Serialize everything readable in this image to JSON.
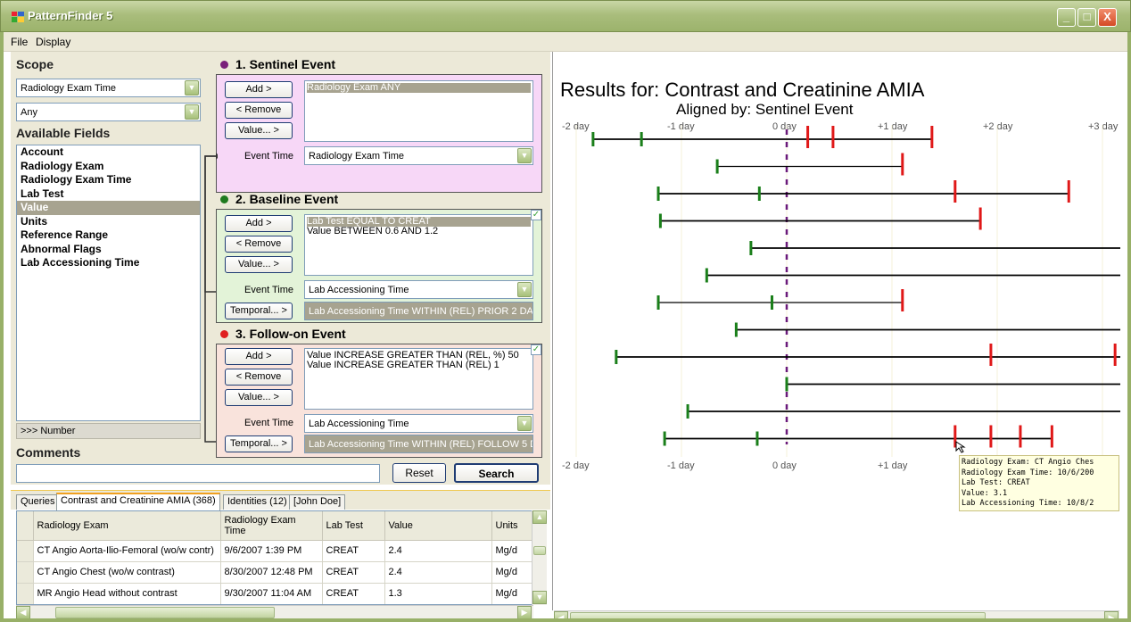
{
  "window": {
    "title": "PatternFinder 5",
    "minimize": "_",
    "maximize": "□",
    "close": "X"
  },
  "menu": [
    "File",
    "Display"
  ],
  "scope": {
    "label": "Scope",
    "field": "Radiology Exam Time",
    "qualifier": "Any"
  },
  "available_fields": {
    "label": "Available Fields",
    "items": [
      "Account",
      "Radiology Exam",
      "Radiology Exam Time",
      "Lab Test",
      "Value",
      "Units",
      "Reference Range",
      "Abnormal Flags",
      "Lab Accessioning Time"
    ],
    "selected": "Value",
    "number_button": ">>> Number"
  },
  "buttons": {
    "add": "Add >",
    "remove": "< Remove",
    "value": "Value... >",
    "temporal": "Temporal... >"
  },
  "events": [
    {
      "title": "1. Sentinel Event",
      "dot_color": "#7a1f7a",
      "bg": "#f7d7f7",
      "conditions": [
        "Radiology Exam ANY"
      ],
      "highlight_first": true,
      "time_label": "Event Time",
      "time_value": "Radiology Exam Time"
    },
    {
      "title": "2. Baseline Event",
      "dot_color": "#1f7a1f",
      "bg": "#e3f3d8",
      "conditions": [
        "Lab Test EQUAL TO CREAT",
        "Value BETWEEN 0.6 AND 1.2"
      ],
      "highlight_first": true,
      "time_label": "Event Time",
      "time_value": "Lab Accessioning Time",
      "temporal": "Lab Accessioning Time WITHIN (REL) PRIOR 2 DA"
    },
    {
      "title": "3.  Follow-on Event",
      "dot_color": "#e02020",
      "bg": "#f9e3dc",
      "conditions": [
        "Value INCREASE GREATER THAN (REL, %) 50",
        "Value INCREASE GREATER THAN (REL) 1"
      ],
      "highlight_first": false,
      "time_label": "Event Time",
      "time_value": "Lab Accessioning Time",
      "temporal": "Lab Accessioning Time WITHIN (REL) FOLLOW 5 D"
    }
  ],
  "comments": {
    "label": "Comments",
    "value": ""
  },
  "actions": {
    "reset": "Reset",
    "search": "Search"
  },
  "tabs": [
    "Queries",
    "Contrast and Creatinine AMIA  (368)",
    "Identities (12)",
    "[John Doe]"
  ],
  "active_tab": 1,
  "grid": {
    "columns": [
      "Radiology Exam",
      "Radiology Exam Time",
      "Lab Test",
      "Value",
      "Units"
    ],
    "rows": [
      [
        "CT Angio Aorta-Ilio-Femoral (wo/w contr)",
        "9/6/2007 1:39 PM",
        "CREAT",
        "2.4",
        "Mg/d"
      ],
      [
        "CT Angio Chest (wo/w contrast)",
        "8/30/2007 12:48 PM",
        "CREAT",
        "2.4",
        "Mg/d"
      ],
      [
        "MR Angio Head without contrast",
        "9/30/2007 11:04 AM",
        "CREAT",
        "1.3",
        "Mg/d"
      ]
    ]
  },
  "results": {
    "title": "Results for: Contrast and Creatinine AMIA",
    "aligned_by": "Aligned by: Sentinel Event",
    "top_ticks": [
      "-2 day",
      "-1 day",
      "0 day",
      "+1 day",
      "+2 day",
      "+3 day"
    ],
    "bottom_ticks": [
      "-2 day",
      "-1 day",
      "0 day",
      "+1 day"
    ],
    "colors": {
      "baseline": "#1a7f1a",
      "followon": "#e01818",
      "sentinel": "#6a1a7a",
      "grid": "#f4f0d8"
    },
    "timelines": [
      {
        "start": -1.84,
        "end": 1.38,
        "baseline": [
          -1.84,
          -1.38
        ],
        "followon": [
          0.2,
          0.44,
          1.38
        ]
      },
      {
        "start": -0.66,
        "end": 1.1,
        "baseline": [
          -0.66
        ],
        "followon": [
          1.1
        ]
      },
      {
        "start": -1.22,
        "end": 2.68,
        "baseline": [
          -1.22,
          -0.26
        ],
        "followon": [
          1.6,
          2.68
        ]
      },
      {
        "start": -1.2,
        "end": 1.84,
        "baseline": [
          -1.2
        ],
        "followon": [
          1.84
        ]
      },
      {
        "start": -0.34,
        "end": 3.2,
        "baseline": [
          -0.34
        ],
        "followon": []
      },
      {
        "start": -0.76,
        "end": 3.2,
        "baseline": [
          -0.76
        ],
        "followon": []
      },
      {
        "start": -1.22,
        "end": 1.1,
        "baseline": [
          -1.22,
          -0.14
        ],
        "followon": [
          1.1
        ]
      },
      {
        "start": -0.48,
        "end": 3.2,
        "baseline": [
          -0.48
        ],
        "followon": []
      },
      {
        "start": -1.62,
        "end": 3.2,
        "baseline": [
          -1.62
        ],
        "followon": [
          1.94,
          3.12
        ]
      },
      {
        "start": 0.0,
        "end": 3.2,
        "baseline": [
          0.0
        ],
        "followon": []
      },
      {
        "start": -0.94,
        "end": 3.2,
        "baseline": [
          -0.94
        ],
        "followon": []
      },
      {
        "start": -1.16,
        "end": 2.52,
        "baseline": [
          -1.16,
          -0.28
        ],
        "followon": [
          1.6,
          1.94,
          2.22,
          2.52
        ]
      }
    ],
    "tooltip": [
      "Radiology Exam: CT Angio Ches",
      "Radiology Exam Time: 10/6/200",
      "Lab Test: CREAT",
      "Value: 3.1",
      "Lab Accessioning Time: 10/8/2"
    ]
  }
}
